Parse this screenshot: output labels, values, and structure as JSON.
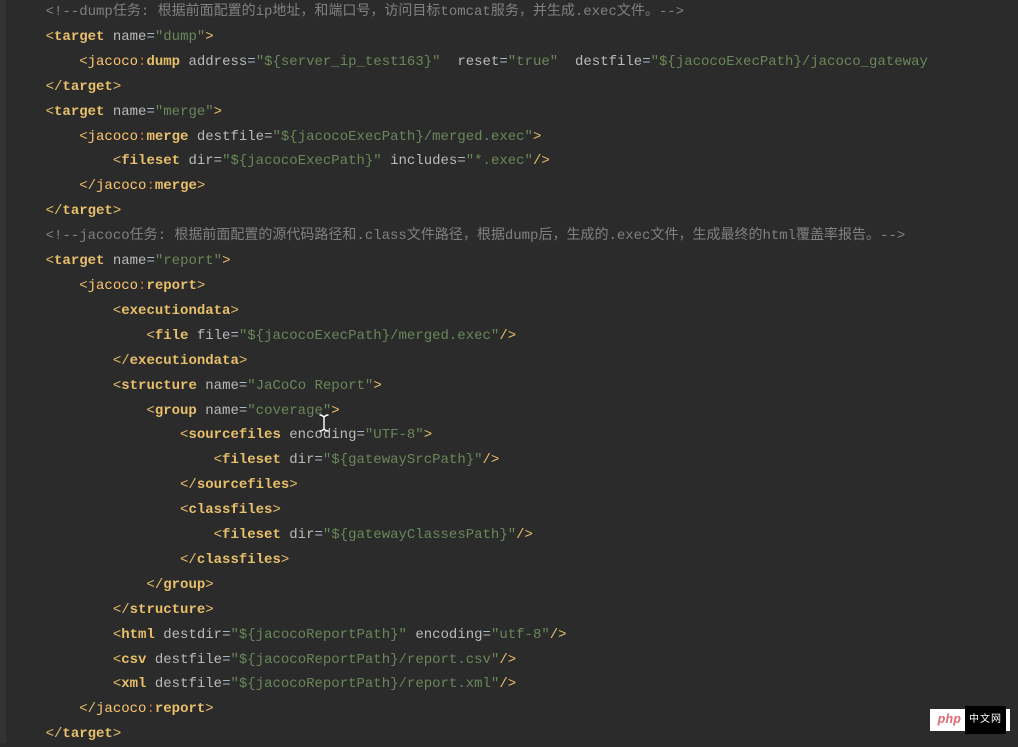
{
  "watermark": {
    "php": "php",
    "cn": "中文网"
  },
  "cursor": {
    "name": "text-cursor-icon"
  },
  "lines": [
    [
      {
        "i": 1,
        "c": "comment",
        "t": "<!--dump任务: 根据前面配置的ip地址，和端口号，访问目标tomcat服务，并生成.exec文件。-->"
      }
    ],
    [
      {
        "i": 1,
        "c": "br",
        "t": "<"
      },
      {
        "c": "tag",
        "t": "target"
      },
      {
        "t": " "
      },
      {
        "c": "attr",
        "t": "name"
      },
      {
        "c": "eq",
        "t": "="
      },
      {
        "c": "str",
        "t": "\"dump\""
      },
      {
        "c": "br",
        "t": ">"
      }
    ],
    [
      {
        "i": 2,
        "c": "br",
        "t": "<"
      },
      {
        "c": "ns",
        "t": "jacoco"
      },
      {
        "c": "colon",
        "t": ":"
      },
      {
        "c": "tag",
        "t": "dump"
      },
      {
        "t": " "
      },
      {
        "c": "attr",
        "t": "address"
      },
      {
        "c": "eq",
        "t": "="
      },
      {
        "c": "str",
        "t": "\"${server_ip_test163}\""
      },
      {
        "t": "  "
      },
      {
        "c": "attr",
        "t": "reset"
      },
      {
        "c": "eq",
        "t": "="
      },
      {
        "c": "str",
        "t": "\"true\""
      },
      {
        "t": "  "
      },
      {
        "c": "attr",
        "t": "destfile"
      },
      {
        "c": "eq",
        "t": "="
      },
      {
        "c": "str",
        "t": "\"${jacocoExecPath}/jacoco_gateway"
      }
    ],
    [
      {
        "i": 1,
        "c": "br",
        "t": "</"
      },
      {
        "c": "tag",
        "t": "target"
      },
      {
        "c": "br",
        "t": ">"
      }
    ],
    [
      {
        "i": 1,
        "c": "br",
        "t": "<"
      },
      {
        "c": "tag",
        "t": "target"
      },
      {
        "t": " "
      },
      {
        "c": "attr",
        "t": "name"
      },
      {
        "c": "eq",
        "t": "="
      },
      {
        "c": "str",
        "t": "\"merge\""
      },
      {
        "c": "br",
        "t": ">"
      }
    ],
    [
      {
        "i": 2,
        "c": "br",
        "t": "<"
      },
      {
        "c": "ns",
        "t": "jacoco"
      },
      {
        "c": "colon",
        "t": ":"
      },
      {
        "c": "tag",
        "t": "merge"
      },
      {
        "t": " "
      },
      {
        "c": "attr",
        "t": "destfile"
      },
      {
        "c": "eq",
        "t": "="
      },
      {
        "c": "str",
        "t": "\"${jacocoExecPath}/merged.exec\""
      },
      {
        "c": "br",
        "t": ">"
      }
    ],
    [
      {
        "i": 3,
        "c": "br",
        "t": "<"
      },
      {
        "c": "tag",
        "t": "fileset"
      },
      {
        "t": " "
      },
      {
        "c": "attr",
        "t": "dir"
      },
      {
        "c": "eq",
        "t": "="
      },
      {
        "c": "str",
        "t": "\"${jacocoExecPath}\""
      },
      {
        "t": " "
      },
      {
        "c": "attr",
        "t": "includes"
      },
      {
        "c": "eq",
        "t": "="
      },
      {
        "c": "str",
        "t": "\"*.exec\""
      },
      {
        "c": "br",
        "t": "/>"
      }
    ],
    [
      {
        "i": 2,
        "c": "br",
        "t": "</"
      },
      {
        "c": "ns",
        "t": "jacoco"
      },
      {
        "c": "colon",
        "t": ":"
      },
      {
        "c": "tag",
        "t": "merge"
      },
      {
        "c": "br",
        "t": ">"
      }
    ],
    [
      {
        "i": 1,
        "c": "br",
        "t": "</"
      },
      {
        "c": "tag",
        "t": "target"
      },
      {
        "c": "br",
        "t": ">"
      }
    ],
    [
      {
        "i": 1,
        "c": "comment",
        "t": "<!--jacoco任务: 根据前面配置的源代码路径和.class文件路径，根据dump后，生成的.exec文件，生成最终的html覆盖率报告。-->"
      }
    ],
    [
      {
        "i": 1,
        "c": "br",
        "t": "<"
      },
      {
        "c": "tag",
        "t": "target"
      },
      {
        "t": " "
      },
      {
        "c": "attr",
        "t": "name"
      },
      {
        "c": "eq",
        "t": "="
      },
      {
        "c": "str",
        "t": "\"report\""
      },
      {
        "c": "br",
        "t": ">"
      }
    ],
    [
      {
        "i": 2,
        "c": "br",
        "t": "<"
      },
      {
        "c": "ns",
        "t": "jacoco"
      },
      {
        "c": "colon",
        "t": ":"
      },
      {
        "c": "tag",
        "t": "report"
      },
      {
        "c": "br",
        "t": ">"
      }
    ],
    [
      {
        "i": 3,
        "c": "br",
        "t": "<"
      },
      {
        "c": "tag",
        "t": "executiondata"
      },
      {
        "c": "br",
        "t": ">"
      }
    ],
    [
      {
        "i": 4,
        "c": "br",
        "t": "<"
      },
      {
        "c": "tag",
        "t": "file"
      },
      {
        "t": " "
      },
      {
        "c": "attr",
        "t": "file"
      },
      {
        "c": "eq",
        "t": "="
      },
      {
        "c": "str",
        "t": "\"${jacocoExecPath}/merged.exec\""
      },
      {
        "c": "br",
        "t": "/>"
      }
    ],
    [
      {
        "i": 3,
        "c": "br",
        "t": "</"
      },
      {
        "c": "tag",
        "t": "executiondata"
      },
      {
        "c": "br",
        "t": ">"
      }
    ],
    [
      {
        "i": 3,
        "c": "br",
        "t": "<"
      },
      {
        "c": "tag",
        "t": "structure"
      },
      {
        "t": " "
      },
      {
        "c": "attr",
        "t": "name"
      },
      {
        "c": "eq",
        "t": "="
      },
      {
        "c": "str",
        "t": "\"JaCoCo Report\""
      },
      {
        "c": "br",
        "t": ">"
      }
    ],
    [
      {
        "i": 4,
        "c": "br",
        "t": "<"
      },
      {
        "c": "tag",
        "t": "group"
      },
      {
        "t": " "
      },
      {
        "c": "attr",
        "t": "name"
      },
      {
        "c": "eq",
        "t": "="
      },
      {
        "c": "str",
        "t": "\"coverage\""
      },
      {
        "c": "br",
        "t": ">"
      }
    ],
    [
      {
        "i": 5,
        "c": "br",
        "t": "<"
      },
      {
        "c": "tag",
        "t": "sourcefiles"
      },
      {
        "t": " "
      },
      {
        "c": "attr",
        "t": "encoding"
      },
      {
        "c": "eq",
        "t": "="
      },
      {
        "c": "str",
        "t": "\"UTF-8\""
      },
      {
        "c": "br",
        "t": ">"
      }
    ],
    [
      {
        "i": 6,
        "c": "br",
        "t": "<"
      },
      {
        "c": "tag",
        "t": "fileset"
      },
      {
        "t": " "
      },
      {
        "c": "attr",
        "t": "dir"
      },
      {
        "c": "eq",
        "t": "="
      },
      {
        "c": "str",
        "t": "\"${gatewaySrcPath}\""
      },
      {
        "c": "br",
        "t": "/>"
      }
    ],
    [
      {
        "i": 5,
        "c": "br",
        "t": "</"
      },
      {
        "c": "tag",
        "t": "sourcefiles"
      },
      {
        "c": "br",
        "t": ">"
      }
    ],
    [
      {
        "i": 5,
        "c": "br",
        "t": "<"
      },
      {
        "c": "tag",
        "t": "classfiles"
      },
      {
        "c": "br",
        "t": ">"
      }
    ],
    [
      {
        "i": 6,
        "c": "br",
        "t": "<"
      },
      {
        "c": "tag",
        "t": "fileset"
      },
      {
        "t": " "
      },
      {
        "c": "attr",
        "t": "dir"
      },
      {
        "c": "eq",
        "t": "="
      },
      {
        "c": "str",
        "t": "\"${gatewayClassesPath}\""
      },
      {
        "c": "br",
        "t": "/>"
      }
    ],
    [
      {
        "i": 5,
        "c": "br",
        "t": "</"
      },
      {
        "c": "tag",
        "t": "classfiles"
      },
      {
        "c": "br",
        "t": ">"
      }
    ],
    [
      {
        "i": 4,
        "c": "br",
        "t": "</"
      },
      {
        "c": "tag",
        "t": "group"
      },
      {
        "c": "br",
        "t": ">"
      }
    ],
    [
      {
        "i": 3,
        "c": "br",
        "t": "</"
      },
      {
        "c": "tag",
        "t": "structure"
      },
      {
        "c": "br",
        "t": ">"
      }
    ],
    [
      {
        "i": 3,
        "c": "br",
        "t": "<"
      },
      {
        "c": "tag",
        "t": "html"
      },
      {
        "t": " "
      },
      {
        "c": "attr",
        "t": "destdir"
      },
      {
        "c": "eq",
        "t": "="
      },
      {
        "c": "str",
        "t": "\"${jacocoReportPath}\""
      },
      {
        "t": " "
      },
      {
        "c": "attr",
        "t": "encoding"
      },
      {
        "c": "eq",
        "t": "="
      },
      {
        "c": "str",
        "t": "\"utf-8\""
      },
      {
        "c": "br",
        "t": "/>"
      }
    ],
    [
      {
        "i": 3,
        "c": "br",
        "t": "<"
      },
      {
        "c": "tag",
        "t": "csv"
      },
      {
        "t": " "
      },
      {
        "c": "attr",
        "t": "destfile"
      },
      {
        "c": "eq",
        "t": "="
      },
      {
        "c": "str",
        "t": "\"${jacocoReportPath}/report.csv\""
      },
      {
        "c": "br",
        "t": "/>"
      }
    ],
    [
      {
        "i": 3,
        "c": "br",
        "t": "<"
      },
      {
        "c": "tag",
        "t": "xml"
      },
      {
        "t": " "
      },
      {
        "c": "attr",
        "t": "destfile"
      },
      {
        "c": "eq",
        "t": "="
      },
      {
        "c": "str",
        "t": "\"${jacocoReportPath}/report.xml\""
      },
      {
        "c": "br",
        "t": "/>"
      }
    ],
    [
      {
        "i": 2,
        "c": "br",
        "t": "</"
      },
      {
        "c": "ns",
        "t": "jacoco"
      },
      {
        "c": "colon",
        "t": ":"
      },
      {
        "c": "tag",
        "t": "report"
      },
      {
        "c": "br",
        "t": ">"
      }
    ],
    [
      {
        "i": 1,
        "c": "br",
        "t": "</"
      },
      {
        "c": "tag",
        "t": "target"
      },
      {
        "c": "br",
        "t": ">"
      }
    ]
  ]
}
